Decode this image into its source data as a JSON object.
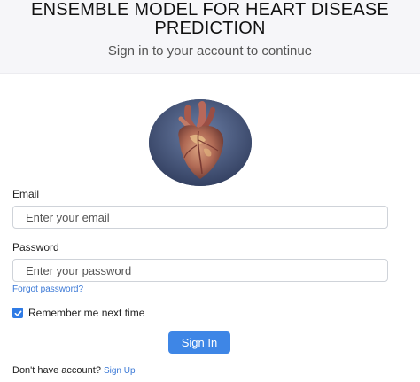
{
  "header": {
    "title_line1": "ENSEMBLE MODEL FOR HEART DISEASE",
    "title_line2": "PREDICTION",
    "subtitle": "Sign in to your account to continue"
  },
  "avatar": {
    "icon": "anatomical-heart-image"
  },
  "form": {
    "email_label": "Email",
    "email_placeholder": "Enter your email",
    "password_label": "Password",
    "password_placeholder": "Enter your password",
    "forgot_link": "Forgot password?",
    "remember_label": "Remember me next time",
    "remember_checked": true,
    "signin_button": "Sign In"
  },
  "footer": {
    "prompt": "Don't have account?",
    "signup_link": "Sign Up"
  },
  "colors": {
    "accent": "#3e86e6",
    "link": "#3a78d6",
    "header_bg": "#f6f6f9"
  }
}
